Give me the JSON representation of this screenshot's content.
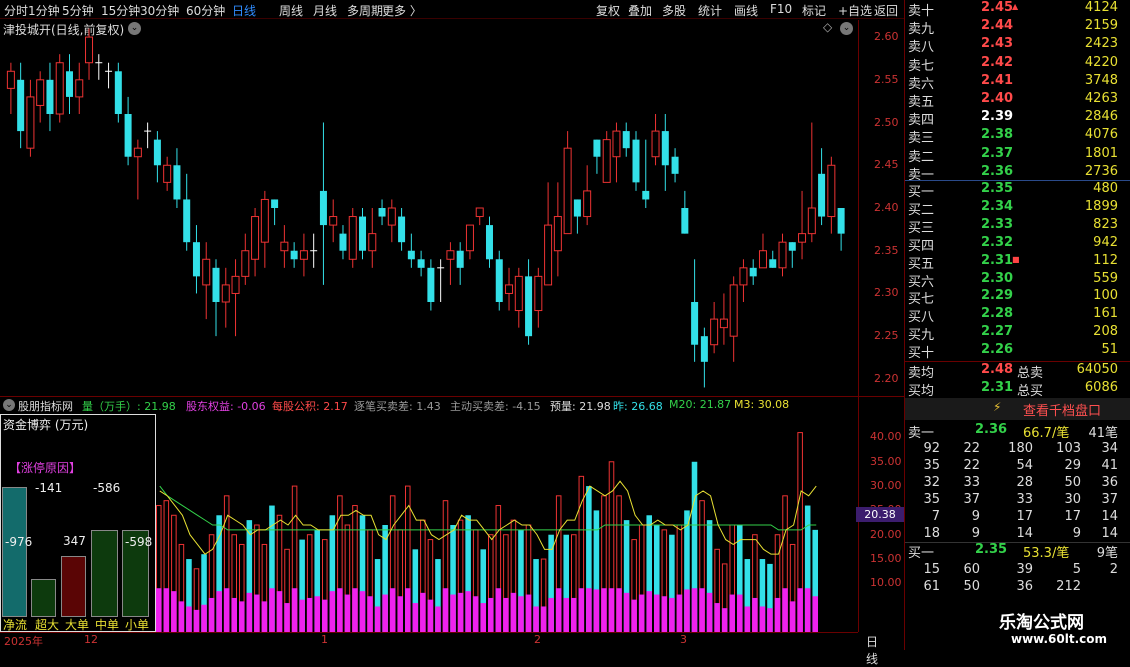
{
  "toolbar": {
    "left": [
      "分时",
      "1分钟",
      "5分钟",
      "15分钟",
      "30分钟",
      "60分钟",
      "日线",
      "周线",
      "月线",
      "多周期",
      "更多 〉"
    ],
    "active": "日线",
    "right": [
      "复权",
      "叠加",
      "多股",
      "统计",
      "画线",
      "F10",
      "标记",
      "+自选",
      "返回"
    ]
  },
  "stock_title": "津投城开(日线,前复权)",
  "price_axis": [
    "2.60",
    "2.55",
    "2.50",
    "2.45",
    "2.40",
    "2.35",
    "2.30",
    "2.25",
    "2.20"
  ],
  "indicator_axis": [
    "40.00",
    "35.00",
    "30.00",
    "25.00",
    "20.00",
    "15.00",
    "10.00"
  ],
  "indicator_current": "20.38",
  "indicator_header": {
    "name": "股朋指标网",
    "vol_label": "量（万手）: 21.98",
    "equity": "股东权益: -0.06",
    "nav": "每股公积: 2.17",
    "gap": "逐笔买卖差: 1.43",
    "active_gap": "主动买卖差: -4.15",
    "pre_vol": "预量: 21.98",
    "yesterday": "昨: 26.68",
    "m20": "M20: 21.87",
    "m3": "M3: 30.08"
  },
  "fund_panel": {
    "title": "资金博弈 (万元)",
    "limit_reason": "【涨停原因】",
    "values": [
      "-976",
      "-141",
      "347",
      "-586",
      "-598"
    ],
    "labels": [
      "净流",
      "超大",
      "大单",
      "中单",
      "小单"
    ]
  },
  "x_axis": {
    "period": "日线",
    "ticks": [
      "2025年",
      "12",
      "1",
      "2",
      "3"
    ]
  },
  "order_book": {
    "sell": [
      {
        "label": "卖十",
        "price": "2.45",
        "vol": "4124",
        "cls": "up",
        "mark": "▲"
      },
      {
        "label": "卖九",
        "price": "2.44",
        "vol": "2159",
        "cls": "up"
      },
      {
        "label": "卖八",
        "price": "2.43",
        "vol": "2423",
        "cls": "up"
      },
      {
        "label": "卖七",
        "price": "2.42",
        "vol": "4220",
        "cls": "up"
      },
      {
        "label": "卖六",
        "price": "2.41",
        "vol": "3748",
        "cls": "up"
      },
      {
        "label": "卖五",
        "price": "2.40",
        "vol": "4263",
        "cls": "up"
      },
      {
        "label": "卖四",
        "price": "2.39",
        "vol": "2846",
        "cls": "fl"
      },
      {
        "label": "卖三",
        "price": "2.38",
        "vol": "4076",
        "cls": "dn"
      },
      {
        "label": "卖二",
        "price": "2.37",
        "vol": "1801",
        "cls": "dn"
      },
      {
        "label": "卖一",
        "price": "2.36",
        "vol": "2736",
        "cls": "dn"
      }
    ],
    "buy": [
      {
        "label": "买一",
        "price": "2.35",
        "vol": "480",
        "cls": "dn"
      },
      {
        "label": "买二",
        "price": "2.34",
        "vol": "1899",
        "cls": "dn"
      },
      {
        "label": "买三",
        "price": "2.33",
        "vol": "823",
        "cls": "dn"
      },
      {
        "label": "买四",
        "price": "2.32",
        "vol": "942",
        "cls": "dn"
      },
      {
        "label": "买五",
        "price": "2.31",
        "vol": "112",
        "cls": "dn",
        "mark": "■"
      },
      {
        "label": "买六",
        "price": "2.30",
        "vol": "559",
        "cls": "dn"
      },
      {
        "label": "买七",
        "price": "2.29",
        "vol": "100",
        "cls": "dn"
      },
      {
        "label": "买八",
        "price": "2.28",
        "vol": "161",
        "cls": "dn"
      },
      {
        "label": "买九",
        "price": "2.27",
        "vol": "208",
        "cls": "dn"
      },
      {
        "label": "买十",
        "price": "2.26",
        "vol": "51",
        "cls": "dn"
      }
    ],
    "sell_avg": {
      "label": "卖均",
      "price": "2.48",
      "total_label": "总卖",
      "total": "64050"
    },
    "buy_avg": {
      "label": "买均",
      "price": "2.31",
      "total_label": "总买",
      "total": "6086"
    }
  },
  "queue": {
    "button": "查看千档盘口",
    "sell1": {
      "label": "卖一",
      "price": "2.36",
      "avg": "66.7/笔",
      "count": "41笔"
    },
    "sell_rows": [
      [
        "92",
        "22",
        "180",
        "103",
        "34"
      ],
      [
        "35",
        "22",
        "54",
        "29",
        "41"
      ],
      [
        "32",
        "33",
        "28",
        "50",
        "36"
      ],
      [
        "35",
        "37",
        "33",
        "30",
        "37"
      ],
      [
        "7",
        "9",
        "17",
        "17",
        "14"
      ],
      [
        "18",
        "9",
        "14",
        "9",
        "14"
      ]
    ],
    "buy1": {
      "label": "买一",
      "price": "2.35",
      "avg": "53.3/笔",
      "count": "9笔"
    },
    "buy_rows": [
      [
        "15",
        "60",
        "39",
        "5",
        "2"
      ],
      [
        "61",
        "50",
        "36",
        "212",
        ""
      ]
    ]
  },
  "watermark": {
    "name": "乐淘公式网",
    "url": "www.60lt.com"
  },
  "colors": {
    "up": "#ff4a4a",
    "down": "#33e0e8",
    "vol_magenta": "#ee22ee",
    "ma": "#e8e033",
    "m20": "#33d14a"
  },
  "chart_data": {
    "type": "candlestick",
    "ylim": [
      2.18,
      2.62
    ],
    "candles": [
      [
        2.54,
        2.56,
        2.51,
        2.57
      ],
      [
        2.55,
        2.49,
        2.47,
        2.57
      ],
      [
        2.47,
        2.53,
        2.46,
        2.55
      ],
      [
        2.52,
        2.55,
        2.5,
        2.56
      ],
      [
        2.55,
        2.51,
        2.49,
        2.57
      ],
      [
        2.51,
        2.57,
        2.5,
        2.58
      ],
      [
        2.56,
        2.53,
        2.51,
        2.58
      ],
      [
        2.53,
        2.55,
        2.51,
        2.57
      ],
      [
        2.57,
        2.6,
        2.55,
        2.61
      ],
      [
        2.57,
        2.57,
        2.55,
        2.58
      ],
      [
        2.56,
        2.56,
        2.54,
        2.57
      ],
      [
        2.56,
        2.51,
        2.5,
        2.57
      ],
      [
        2.51,
        2.46,
        2.45,
        2.53
      ],
      [
        2.46,
        2.47,
        2.41,
        2.48
      ],
      [
        2.49,
        2.49,
        2.47,
        2.5
      ],
      [
        2.48,
        2.45,
        2.43,
        2.49
      ],
      [
        2.43,
        2.45,
        2.42,
        2.46
      ],
      [
        2.45,
        2.41,
        2.4,
        2.47
      ],
      [
        2.41,
        2.36,
        2.35,
        2.44
      ],
      [
        2.36,
        2.32,
        2.3,
        2.38
      ],
      [
        2.31,
        2.34,
        2.27,
        2.36
      ],
      [
        2.33,
        2.29,
        2.25,
        2.34
      ],
      [
        2.29,
        2.31,
        2.26,
        2.33
      ],
      [
        2.3,
        2.32,
        2.25,
        2.34
      ],
      [
        2.32,
        2.35,
        2.31,
        2.37
      ],
      [
        2.34,
        2.39,
        2.32,
        2.4
      ],
      [
        2.36,
        2.41,
        2.33,
        2.42
      ],
      [
        2.41,
        2.4,
        2.38,
        2.41
      ],
      [
        2.35,
        2.36,
        2.33,
        2.38
      ],
      [
        2.35,
        2.34,
        2.33,
        2.36
      ],
      [
        2.34,
        2.35,
        2.32,
        2.37
      ],
      [
        2.35,
        2.35,
        2.33,
        2.37
      ],
      [
        2.42,
        2.38,
        2.31,
        2.5
      ],
      [
        2.38,
        2.39,
        2.36,
        2.41
      ],
      [
        2.37,
        2.35,
        2.34,
        2.38
      ],
      [
        2.34,
        2.39,
        2.33,
        2.4
      ],
      [
        2.39,
        2.35,
        2.34,
        2.4
      ],
      [
        2.35,
        2.37,
        2.33,
        2.4
      ],
      [
        2.4,
        2.39,
        2.38,
        2.41
      ],
      [
        2.38,
        2.4,
        2.36,
        2.41
      ],
      [
        2.39,
        2.36,
        2.35,
        2.4
      ],
      [
        2.35,
        2.34,
        2.33,
        2.37
      ],
      [
        2.34,
        2.33,
        2.32,
        2.35
      ],
      [
        2.33,
        2.29,
        2.28,
        2.34
      ],
      [
        2.33,
        2.33,
        2.29,
        2.34
      ],
      [
        2.34,
        2.35,
        2.31,
        2.36
      ],
      [
        2.35,
        2.33,
        2.31,
        2.36
      ],
      [
        2.35,
        2.38,
        2.34,
        2.38
      ],
      [
        2.39,
        2.4,
        2.38,
        2.4
      ],
      [
        2.38,
        2.34,
        2.33,
        2.39
      ],
      [
        2.34,
        2.29,
        2.28,
        2.35
      ],
      [
        2.3,
        2.31,
        2.28,
        2.33
      ],
      [
        2.28,
        2.32,
        2.26,
        2.33
      ],
      [
        2.32,
        2.25,
        2.24,
        2.34
      ],
      [
        2.28,
        2.32,
        2.26,
        2.33
      ],
      [
        2.31,
        2.38,
        2.31,
        2.43
      ],
      [
        2.35,
        2.39,
        2.32,
        2.43
      ],
      [
        2.37,
        2.47,
        2.37,
        2.49
      ],
      [
        2.41,
        2.39,
        2.37,
        2.41
      ],
      [
        2.39,
        2.42,
        2.38,
        2.45
      ],
      [
        2.48,
        2.46,
        2.44,
        2.48
      ],
      [
        2.43,
        2.48,
        2.43,
        2.49
      ],
      [
        2.46,
        2.49,
        2.43,
        2.5
      ],
      [
        2.49,
        2.47,
        2.46,
        2.5
      ],
      [
        2.48,
        2.43,
        2.42,
        2.49
      ],
      [
        2.42,
        2.41,
        2.4,
        2.48
      ],
      [
        2.46,
        2.49,
        2.45,
        2.51
      ],
      [
        2.49,
        2.45,
        2.42,
        2.51
      ],
      [
        2.46,
        2.44,
        2.43,
        2.47
      ],
      [
        2.4,
        2.37,
        2.37,
        2.42
      ],
      [
        2.29,
        2.24,
        2.22,
        2.34
      ],
      [
        2.25,
        2.22,
        2.19,
        2.26
      ],
      [
        2.24,
        2.27,
        2.23,
        2.29
      ],
      [
        2.26,
        2.27,
        2.24,
        2.3
      ],
      [
        2.25,
        2.31,
        2.22,
        2.32
      ],
      [
        2.31,
        2.33,
        2.29,
        2.34
      ],
      [
        2.33,
        2.32,
        2.31,
        2.34
      ],
      [
        2.33,
        2.35,
        2.33,
        2.37
      ],
      [
        2.34,
        2.33,
        2.33,
        2.35
      ],
      [
        2.33,
        2.36,
        2.32,
        2.37
      ],
      [
        2.36,
        2.35,
        2.33,
        2.36
      ],
      [
        2.36,
        2.37,
        2.34,
        2.42
      ],
      [
        2.37,
        2.4,
        2.36,
        2.5
      ],
      [
        2.44,
        2.39,
        2.38,
        2.47
      ],
      [
        2.39,
        2.45,
        2.37,
        2.46
      ],
      [
        2.4,
        2.37,
        2.35,
        2.4
      ]
    ],
    "volumes": [
      [
        26,
        0
      ],
      [
        27,
        0
      ],
      [
        24,
        0
      ],
      [
        18,
        0
      ],
      [
        15,
        1
      ],
      [
        13,
        0
      ],
      [
        16,
        1
      ],
      [
        20,
        0
      ],
      [
        24,
        1
      ],
      [
        28,
        0
      ],
      [
        20,
        0
      ],
      [
        18,
        0
      ],
      [
        23,
        1
      ],
      [
        22,
        0
      ],
      [
        18,
        0
      ],
      [
        26,
        1
      ],
      [
        24,
        0
      ],
      [
        17,
        0
      ],
      [
        30,
        0
      ],
      [
        19,
        1
      ],
      [
        20,
        0
      ],
      [
        21,
        1
      ],
      [
        19,
        0
      ],
      [
        24,
        1
      ],
      [
        28,
        0
      ],
      [
        22,
        0
      ],
      [
        26,
        0
      ],
      [
        24,
        1
      ],
      [
        21,
        0
      ],
      [
        15,
        1
      ],
      [
        22,
        1
      ],
      [
        28,
        0
      ],
      [
        21,
        0
      ],
      [
        30,
        0
      ],
      [
        17,
        1
      ],
      [
        23,
        0
      ],
      [
        19,
        0
      ],
      [
        15,
        1
      ],
      [
        27,
        0
      ],
      [
        22,
        1
      ],
      [
        23,
        0
      ],
      [
        24,
        1
      ],
      [
        21,
        0
      ],
      [
        17,
        1
      ],
      [
        20,
        0
      ],
      [
        26,
        0
      ],
      [
        20,
        0
      ],
      [
        23,
        0
      ],
      [
        21,
        1
      ],
      [
        22,
        0
      ],
      [
        15,
        1
      ],
      [
        15,
        0
      ],
      [
        20,
        1
      ],
      [
        28,
        0
      ],
      [
        20,
        1
      ],
      [
        20,
        0
      ],
      [
        32,
        0
      ],
      [
        30,
        1
      ],
      [
        25,
        1
      ],
      [
        28,
        0
      ],
      [
        35,
        0
      ],
      [
        28,
        0
      ],
      [
        23,
        1
      ],
      [
        19,
        0
      ],
      [
        22,
        0
      ],
      [
        24,
        1
      ],
      [
        22,
        1
      ],
      [
        21,
        0
      ],
      [
        20,
        1
      ],
      [
        22,
        0
      ],
      [
        25,
        1
      ],
      [
        35,
        1
      ],
      [
        27,
        0
      ],
      [
        23,
        1
      ],
      [
        17,
        0
      ],
      [
        14,
        0
      ],
      [
        22,
        0
      ],
      [
        22,
        1
      ],
      [
        15,
        1
      ],
      [
        20,
        0
      ],
      [
        15,
        1
      ],
      [
        14,
        1
      ],
      [
        20,
        0
      ],
      [
        28,
        0
      ],
      [
        18,
        0
      ],
      [
        41,
        0
      ],
      [
        26,
        1
      ],
      [
        21,
        1
      ]
    ],
    "ma3": [
      29,
      28,
      26,
      24,
      20,
      18,
      16,
      17,
      20,
      24,
      23,
      22,
      20,
      21,
      21,
      22,
      23,
      22,
      24,
      22,
      22,
      21,
      21,
      21,
      24,
      24,
      25,
      24,
      24,
      20,
      19,
      22,
      24,
      26,
      23,
      23,
      20,
      19,
      20,
      21,
      24,
      23,
      23,
      21,
      19,
      21,
      22,
      23,
      22,
      22,
      20,
      17,
      17,
      21,
      23,
      23,
      27,
      30,
      29,
      28,
      29,
      31,
      29,
      24,
      22,
      22,
      23,
      22,
      22,
      21,
      22,
      28,
      29,
      28,
      22,
      19,
      18,
      19,
      19,
      19,
      17,
      16,
      16,
      21,
      22,
      29,
      28,
      30
    ],
    "m20": [
      30,
      28,
      27,
      26,
      25,
      24,
      23,
      22,
      22,
      21,
      21,
      21,
      21,
      21,
      21,
      21,
      21,
      21,
      21,
      21,
      21,
      21,
      21,
      21,
      21,
      21,
      21,
      21,
      21,
      21,
      21,
      21,
      21,
      21,
      21,
      21,
      21,
      21,
      21,
      21,
      21,
      21,
      21,
      21,
      21,
      21,
      21,
      21,
      21,
      21,
      21,
      21,
      21,
      21,
      21,
      21,
      21,
      21,
      21,
      22,
      22,
      22,
      22,
      22,
      22,
      22,
      22,
      22,
      22,
      22,
      22,
      22,
      22,
      22,
      22,
      22,
      22,
      22,
      22,
      22,
      22,
      22,
      21,
      21,
      21,
      21,
      22,
      22
    ]
  }
}
